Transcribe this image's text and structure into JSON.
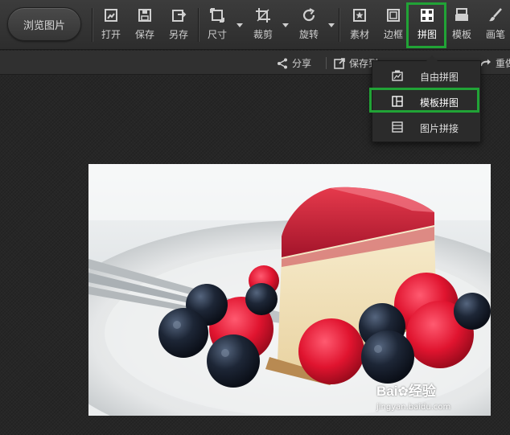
{
  "toolbar": {
    "browse_label": "浏览图片",
    "tools": [
      {
        "label": "打开",
        "icon": "open-icon"
      },
      {
        "label": "保存",
        "icon": "save-icon"
      },
      {
        "label": "另存",
        "icon": "save-as-icon"
      },
      {
        "label": "尺寸",
        "icon": "resize-icon"
      },
      {
        "label": "裁剪",
        "icon": "crop-icon"
      },
      {
        "label": "旋转",
        "icon": "rotate-icon"
      },
      {
        "label": "素材",
        "icon": "sticker-icon"
      },
      {
        "label": "边框",
        "icon": "frame-icon"
      },
      {
        "label": "拼图",
        "icon": "collage-icon"
      },
      {
        "label": "模板",
        "icon": "template-icon"
      },
      {
        "label": "画笔",
        "icon": "brush-icon"
      }
    ]
  },
  "subbar": {
    "share_label": "分享",
    "save_label": "保存到",
    "redo_label": "重做"
  },
  "collage_menu": {
    "items": [
      {
        "label": "自由拼图",
        "icon": "free-collage-icon"
      },
      {
        "label": "模板拼图",
        "icon": "template-collage-icon"
      },
      {
        "label": "图片拼接",
        "icon": "stitch-icon"
      }
    ]
  },
  "photo": {
    "subject": "cheesecake-with-berries"
  },
  "watermark": {
    "brand_left": "Bai",
    "brand_right": "经验",
    "url": "jingyan.baidu.com"
  },
  "colors": {
    "highlight": "#21a336"
  }
}
